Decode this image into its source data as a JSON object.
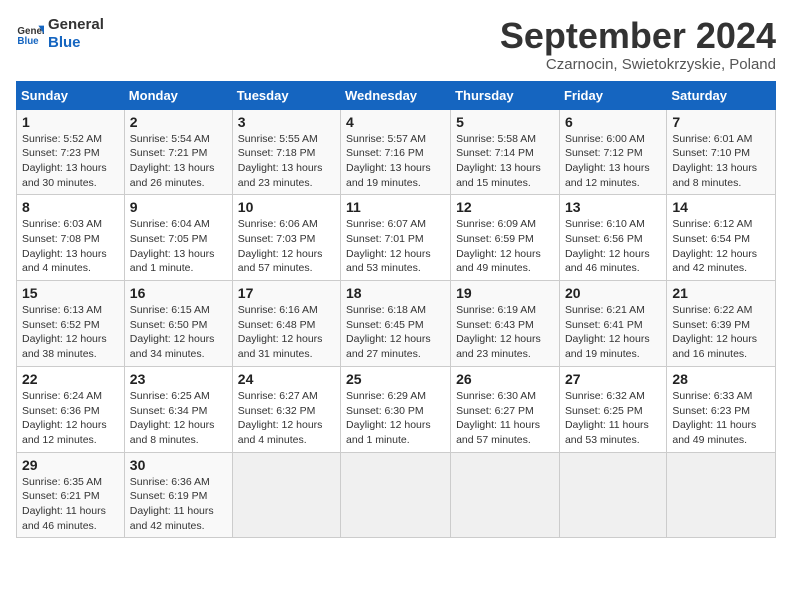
{
  "logo": {
    "line1": "General",
    "line2": "Blue"
  },
  "title": "September 2024",
  "location": "Czarnocin, Swietokrzyskie, Poland",
  "weekdays": [
    "Sunday",
    "Monday",
    "Tuesday",
    "Wednesday",
    "Thursday",
    "Friday",
    "Saturday"
  ],
  "weeks": [
    [
      {
        "day": "1",
        "info": "Sunrise: 5:52 AM\nSunset: 7:23 PM\nDaylight: 13 hours\nand 30 minutes."
      },
      {
        "day": "2",
        "info": "Sunrise: 5:54 AM\nSunset: 7:21 PM\nDaylight: 13 hours\nand 26 minutes."
      },
      {
        "day": "3",
        "info": "Sunrise: 5:55 AM\nSunset: 7:18 PM\nDaylight: 13 hours\nand 23 minutes."
      },
      {
        "day": "4",
        "info": "Sunrise: 5:57 AM\nSunset: 7:16 PM\nDaylight: 13 hours\nand 19 minutes."
      },
      {
        "day": "5",
        "info": "Sunrise: 5:58 AM\nSunset: 7:14 PM\nDaylight: 13 hours\nand 15 minutes."
      },
      {
        "day": "6",
        "info": "Sunrise: 6:00 AM\nSunset: 7:12 PM\nDaylight: 13 hours\nand 12 minutes."
      },
      {
        "day": "7",
        "info": "Sunrise: 6:01 AM\nSunset: 7:10 PM\nDaylight: 13 hours\nand 8 minutes."
      }
    ],
    [
      {
        "day": "8",
        "info": "Sunrise: 6:03 AM\nSunset: 7:08 PM\nDaylight: 13 hours\nand 4 minutes."
      },
      {
        "day": "9",
        "info": "Sunrise: 6:04 AM\nSunset: 7:05 PM\nDaylight: 13 hours\nand 1 minute."
      },
      {
        "day": "10",
        "info": "Sunrise: 6:06 AM\nSunset: 7:03 PM\nDaylight: 12 hours\nand 57 minutes."
      },
      {
        "day": "11",
        "info": "Sunrise: 6:07 AM\nSunset: 7:01 PM\nDaylight: 12 hours\nand 53 minutes."
      },
      {
        "day": "12",
        "info": "Sunrise: 6:09 AM\nSunset: 6:59 PM\nDaylight: 12 hours\nand 49 minutes."
      },
      {
        "day": "13",
        "info": "Sunrise: 6:10 AM\nSunset: 6:56 PM\nDaylight: 12 hours\nand 46 minutes."
      },
      {
        "day": "14",
        "info": "Sunrise: 6:12 AM\nSunset: 6:54 PM\nDaylight: 12 hours\nand 42 minutes."
      }
    ],
    [
      {
        "day": "15",
        "info": "Sunrise: 6:13 AM\nSunset: 6:52 PM\nDaylight: 12 hours\nand 38 minutes."
      },
      {
        "day": "16",
        "info": "Sunrise: 6:15 AM\nSunset: 6:50 PM\nDaylight: 12 hours\nand 34 minutes."
      },
      {
        "day": "17",
        "info": "Sunrise: 6:16 AM\nSunset: 6:48 PM\nDaylight: 12 hours\nand 31 minutes."
      },
      {
        "day": "18",
        "info": "Sunrise: 6:18 AM\nSunset: 6:45 PM\nDaylight: 12 hours\nand 27 minutes."
      },
      {
        "day": "19",
        "info": "Sunrise: 6:19 AM\nSunset: 6:43 PM\nDaylight: 12 hours\nand 23 minutes."
      },
      {
        "day": "20",
        "info": "Sunrise: 6:21 AM\nSunset: 6:41 PM\nDaylight: 12 hours\nand 19 minutes."
      },
      {
        "day": "21",
        "info": "Sunrise: 6:22 AM\nSunset: 6:39 PM\nDaylight: 12 hours\nand 16 minutes."
      }
    ],
    [
      {
        "day": "22",
        "info": "Sunrise: 6:24 AM\nSunset: 6:36 PM\nDaylight: 12 hours\nand 12 minutes."
      },
      {
        "day": "23",
        "info": "Sunrise: 6:25 AM\nSunset: 6:34 PM\nDaylight: 12 hours\nand 8 minutes."
      },
      {
        "day": "24",
        "info": "Sunrise: 6:27 AM\nSunset: 6:32 PM\nDaylight: 12 hours\nand 4 minutes."
      },
      {
        "day": "25",
        "info": "Sunrise: 6:29 AM\nSunset: 6:30 PM\nDaylight: 12 hours\nand 1 minute."
      },
      {
        "day": "26",
        "info": "Sunrise: 6:30 AM\nSunset: 6:27 PM\nDaylight: 11 hours\nand 57 minutes."
      },
      {
        "day": "27",
        "info": "Sunrise: 6:32 AM\nSunset: 6:25 PM\nDaylight: 11 hours\nand 53 minutes."
      },
      {
        "day": "28",
        "info": "Sunrise: 6:33 AM\nSunset: 6:23 PM\nDaylight: 11 hours\nand 49 minutes."
      }
    ],
    [
      {
        "day": "29",
        "info": "Sunrise: 6:35 AM\nSunset: 6:21 PM\nDaylight: 11 hours\nand 46 minutes."
      },
      {
        "day": "30",
        "info": "Sunrise: 6:36 AM\nSunset: 6:19 PM\nDaylight: 11 hours\nand 42 minutes."
      },
      {
        "day": "",
        "info": ""
      },
      {
        "day": "",
        "info": ""
      },
      {
        "day": "",
        "info": ""
      },
      {
        "day": "",
        "info": ""
      },
      {
        "day": "",
        "info": ""
      }
    ]
  ]
}
